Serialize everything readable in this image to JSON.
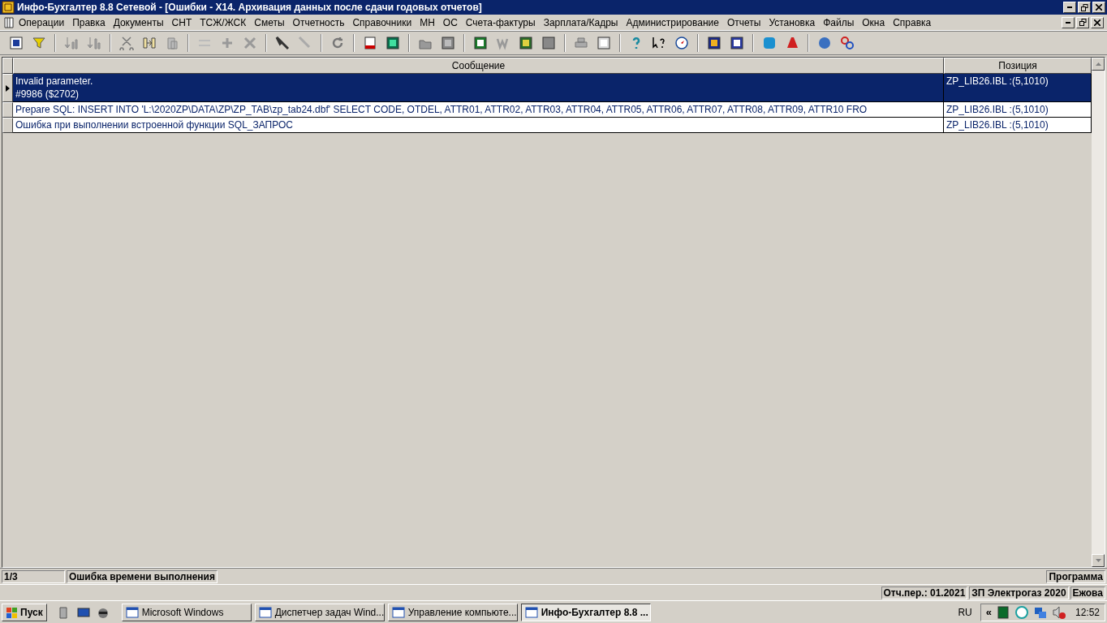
{
  "window": {
    "title": "Инфо-Бухгалтер 8.8 Сетевой - [Ошибки - X14. Архивация данных после сдачи годовых отчетов]"
  },
  "menu": [
    "Операции",
    "Правка",
    "Документы",
    "СНТ",
    "ТСЖ/ЖСК",
    "Сметы",
    "Отчетность",
    "Справочники",
    "МН",
    "ОС",
    "Счета-фактуры",
    "Зарплата/Кадры",
    "Администрирование",
    "Отчеты",
    "Установка",
    "Файлы",
    "Окна",
    "Справка"
  ],
  "table": {
    "columns": [
      "Сообщение",
      "Позиция"
    ],
    "rows": [
      {
        "selected": true,
        "message": [
          "Invalid parameter.",
          "#9986 ($2702)"
        ],
        "position": "ZP_LIB26.IBL :(5,1010)"
      },
      {
        "selected": false,
        "message": [
          "Prepare SQL: INSERT INTO 'L:\\2020ZP\\DATA\\ZP\\ZP_TAB\\zp_tab24.dbf'  SELECT CODE, OTDEL, ATTR01, ATTR02, ATTR03, ATTR04, ATTR05, ATTR06, ATTR07, ATTR08, ATTR09, ATTR10  FRO"
        ],
        "position": "ZP_LIB26.IBL :(5,1010)"
      },
      {
        "selected": false,
        "message": [
          "Ошибка при выполнении встроенной функции SQL_ЗАПРОС"
        ],
        "position": "ZP_LIB26.IBL :(5,1010)"
      }
    ]
  },
  "status_bar": {
    "counter": "1/3",
    "message": "Ошибка времени выполнения",
    "mode": "Программа"
  },
  "info_bar": [
    "Отч.пер.: 01.2021",
    "ЗП Электрогаз 2020",
    "Ежова"
  ],
  "taskbar": {
    "start": "Пуск",
    "tasks": [
      {
        "label": "Microsoft Windows",
        "selected": false
      },
      {
        "label": "Диспетчер задач Wind...",
        "selected": false
      },
      {
        "label": "Управление компьюте...",
        "selected": false
      },
      {
        "label": "Инфо-Бухгалтер 8.8 ...",
        "selected": true
      }
    ],
    "language": "RU",
    "tray_expand": "«",
    "time": "12:52"
  }
}
